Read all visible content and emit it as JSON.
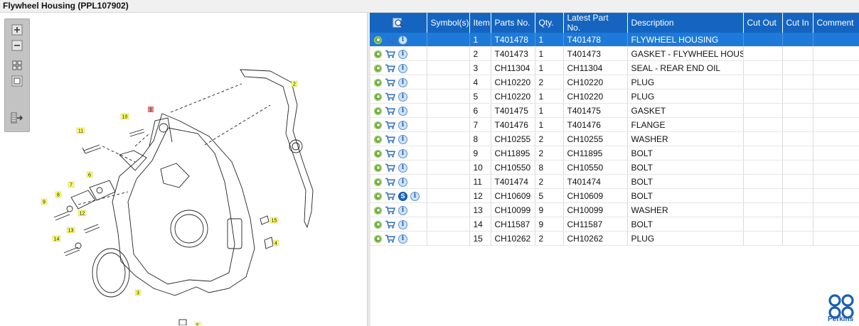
{
  "window": {
    "title": "Flywheel Housing (PPL107902)"
  },
  "toolbar": {
    "buttons": [
      {
        "icon": "zoom-in-icon"
      },
      {
        "icon": "zoom-out-icon"
      },
      {
        "icon": "fit-all-icon"
      },
      {
        "icon": "fit-window-icon"
      },
      {
        "icon": "layout-toggle-icon"
      }
    ]
  },
  "diagram": {
    "callouts": [
      "1",
      "2",
      "3",
      "4",
      "5",
      "6",
      "7",
      "8",
      "9",
      "10",
      "11",
      "12",
      "13",
      "14",
      "15"
    ],
    "highlighted_callout": "1",
    "callout_color": "#ffff66",
    "highlight_color": "#f08080"
  },
  "grid": {
    "columns": [
      "Symbol(s)",
      "Item",
      "Parts No.",
      "Qty.",
      "Latest Part No.",
      "Description",
      "Cut Out",
      "Cut In",
      "Comment"
    ],
    "rows": [
      {
        "item": "1",
        "part": "T401478",
        "qty": "1",
        "latest": "T401478",
        "desc": "FLYWHEEL HOUSING",
        "selected": true,
        "service": false
      },
      {
        "item": "2",
        "part": "T401473",
        "qty": "1",
        "latest": "T401473",
        "desc": "GASKET - FLYWHEEL HOUSING",
        "selected": false,
        "service": false
      },
      {
        "item": "3",
        "part": "CH11304",
        "qty": "1",
        "latest": "CH11304",
        "desc": "SEAL - REAR END OIL",
        "selected": false,
        "service": false
      },
      {
        "item": "4",
        "part": "CH10220",
        "qty": "2",
        "latest": "CH10220",
        "desc": "PLUG",
        "selected": false,
        "service": false
      },
      {
        "item": "5",
        "part": "CH10220",
        "qty": "1",
        "latest": "CH10220",
        "desc": "PLUG",
        "selected": false,
        "service": false
      },
      {
        "item": "6",
        "part": "T401475",
        "qty": "1",
        "latest": "T401475",
        "desc": "GASKET",
        "selected": false,
        "service": false
      },
      {
        "item": "7",
        "part": "T401476",
        "qty": "1",
        "latest": "T401476",
        "desc": "FLANGE",
        "selected": false,
        "service": false
      },
      {
        "item": "8",
        "part": "CH10255",
        "qty": "2",
        "latest": "CH10255",
        "desc": "WASHER",
        "selected": false,
        "service": false
      },
      {
        "item": "9",
        "part": "CH11895",
        "qty": "2",
        "latest": "CH11895",
        "desc": "BOLT",
        "selected": false,
        "service": false
      },
      {
        "item": "10",
        "part": "CH10550",
        "qty": "8",
        "latest": "CH10550",
        "desc": "BOLT",
        "selected": false,
        "service": false
      },
      {
        "item": "11",
        "part": "T401474",
        "qty": "2",
        "latest": "T401474",
        "desc": "BOLT",
        "selected": false,
        "service": false
      },
      {
        "item": "12",
        "part": "CH10609",
        "qty": "5",
        "latest": "CH10609",
        "desc": "BOLT",
        "selected": false,
        "service": true
      },
      {
        "item": "13",
        "part": "CH10099",
        "qty": "9",
        "latest": "CH10099",
        "desc": "WASHER",
        "selected": false,
        "service": false
      },
      {
        "item": "14",
        "part": "CH11587",
        "qty": "9",
        "latest": "CH11587",
        "desc": "BOLT",
        "selected": false,
        "service": false
      },
      {
        "item": "15",
        "part": "CH10262",
        "qty": "2",
        "latest": "CH10262",
        "desc": "PLUG",
        "selected": false,
        "service": false
      }
    ],
    "service_symbol": "S"
  },
  "brand": {
    "name": "Perkins",
    "color": "#1a5fb4"
  },
  "colors": {
    "header_blue": "#1565c0",
    "selected_row": "#1e7ad8"
  }
}
